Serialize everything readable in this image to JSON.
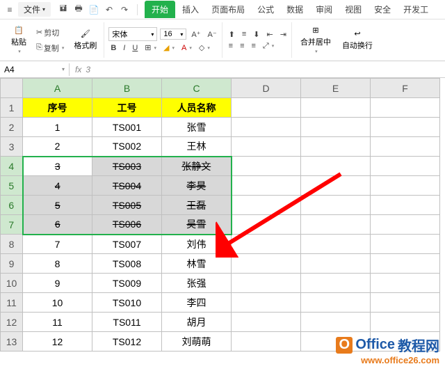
{
  "menubar": {
    "file_label": "文件",
    "tabs": [
      "开始",
      "插入",
      "页面布局",
      "公式",
      "数据",
      "审阅",
      "视图",
      "安全",
      "开发工"
    ]
  },
  "ribbon": {
    "paste": "粘贴",
    "cut": "剪切",
    "copy": "复制",
    "format_painter": "格式刷",
    "font_name": "宋体",
    "font_size": "16",
    "merge_center": "合并居中",
    "wrap_text": "自动换行"
  },
  "namebox": {
    "ref": "A4",
    "fx_value": "3"
  },
  "columns": [
    "A",
    "B",
    "C",
    "D",
    "E",
    "F"
  ],
  "headers": {
    "a": "序号",
    "b": "工号",
    "c": "人员名称"
  },
  "rows": [
    {
      "n": 1,
      "a": "1",
      "b": "TS001",
      "c": "张雪",
      "strike": false,
      "sel": false
    },
    {
      "n": 2,
      "a": "2",
      "b": "TS002",
      "c": "王林",
      "strike": false,
      "sel": false
    },
    {
      "n": 3,
      "a": "3",
      "b": "TS003",
      "c": "张静文",
      "strike": true,
      "sel": true,
      "active": true
    },
    {
      "n": 4,
      "a": "4",
      "b": "TS004",
      "c": "李昊",
      "strike": true,
      "sel": true
    },
    {
      "n": 5,
      "a": "5",
      "b": "TS005",
      "c": "王磊",
      "strike": true,
      "sel": true
    },
    {
      "n": 6,
      "a": "6",
      "b": "TS006",
      "c": "吴雪",
      "strike": true,
      "sel": true
    },
    {
      "n": 7,
      "a": "7",
      "b": "TS007",
      "c": "刘伟",
      "strike": false,
      "sel": false
    },
    {
      "n": 8,
      "a": "8",
      "b": "TS008",
      "c": "林雪",
      "strike": false,
      "sel": false
    },
    {
      "n": 9,
      "a": "9",
      "b": "TS009",
      "c": "张强",
      "strike": false,
      "sel": false
    },
    {
      "n": 10,
      "a": "10",
      "b": "TS010",
      "c": "李四",
      "strike": false,
      "sel": false
    },
    {
      "n": 11,
      "a": "11",
      "b": "TS011",
      "c": "胡月",
      "strike": false,
      "sel": false
    },
    {
      "n": 12,
      "a": "12",
      "b": "TS012",
      "c": "刘萌萌",
      "strike": false,
      "sel": false
    }
  ],
  "watermark": {
    "line1_a": "Office",
    "line1_b": "教程网",
    "line2": "www.office26.com"
  }
}
